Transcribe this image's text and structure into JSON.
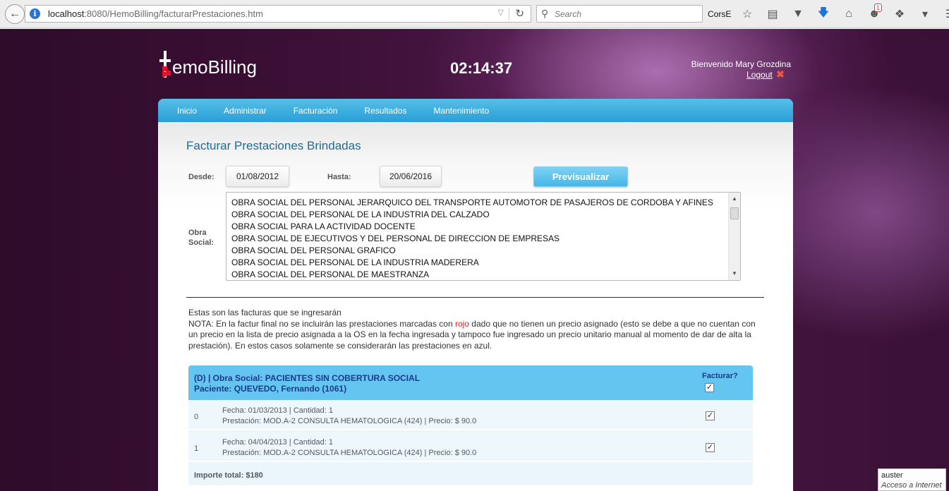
{
  "browser": {
    "url_host": "localhost",
    "url_path": ":8080/HemoBilling/facturarPrestaciones.htm",
    "search_placeholder": "Search",
    "corse_label": "CorsE",
    "notification_count": "1"
  },
  "header": {
    "logo_text": "emoBilling",
    "clock": "02:14:37",
    "welcome": "Bienvenido Mary Grozdina",
    "logout": "Logout"
  },
  "nav": [
    "Inicio",
    "Administrar",
    "Facturación",
    "Resultados",
    "Mantenimiento"
  ],
  "page": {
    "title": "Facturar Prestaciones Brindadas",
    "desde_label": "Desde:",
    "desde_value": "01/08/2012",
    "hasta_label": "Hasta:",
    "hasta_value": "20/06/2016",
    "preview_button": "Previsualizar",
    "obra_social_label_1": "Obra",
    "obra_social_label_2": "Social:",
    "obras_sociales": [
      "OBRA SOCIAL DEL PERSONAL JERARQUICO DEL TRANSPORTE AUTOMOTOR DE PASAJEROS DE CORDOBA Y AFINES",
      "OBRA SOCIAL DEL PERSONAL DE LA INDUSTRIA DEL CALZADO",
      "OBRA SOCIAL PARA LA ACTIVIDAD DOCENTE",
      "OBRA SOCIAL DE EJECUTIVOS Y DEL PERSONAL DE DIRECCION DE EMPRESAS",
      "OBRA SOCIAL DEL PERSONAL GRAFICO",
      "OBRA SOCIAL DEL PERSONAL DE LA INDUSTRIA MADERERA",
      "OBRA SOCIAL DEL PERSONAL DE MAESTRANZA"
    ],
    "info_line": "Estas son las facturas que se ingresarán",
    "note_before": "NOTA: En la factur final no se incluirán las prestaciones marcadas con ",
    "note_red": "rojo",
    "note_after": " dado que no tienen un precio asignado (esto se debe a que no cuentan con un precio en la lista de precio asignada a la OS en la fecha ingresada y tampoco fue ingresado un precio unitario manual al momento de dar de alta la prestación). En estos casos solamente se considerarán las prestaciones en azul."
  },
  "invoice": {
    "title_line1": "(D) | Obra Social: PACIENTES SIN COBERTURA SOCIAL",
    "title_line2": "Paciente: QUEVEDO, Fernando (1061)",
    "facturar_label": "Facturar?",
    "rows": [
      {
        "index": "0",
        "line1": "Fecha: 01/03/2013 | Cantidad: 1",
        "line2": "Prestación: MOD.A-2 CONSULTA HEMATOLOGICA (424) | Precio: $ 90.0"
      },
      {
        "index": "1",
        "line1": "Fecha: 04/04/2013 | Cantidad: 1",
        "line2": "Prestación: MOD.A-2 CONSULTA HEMATOLOGICA (424) | Precio: $ 90.0"
      }
    ],
    "total": "Importe total: $180"
  },
  "tooltip": {
    "line1": "auster",
    "line2": "Acceso a Internet"
  }
}
